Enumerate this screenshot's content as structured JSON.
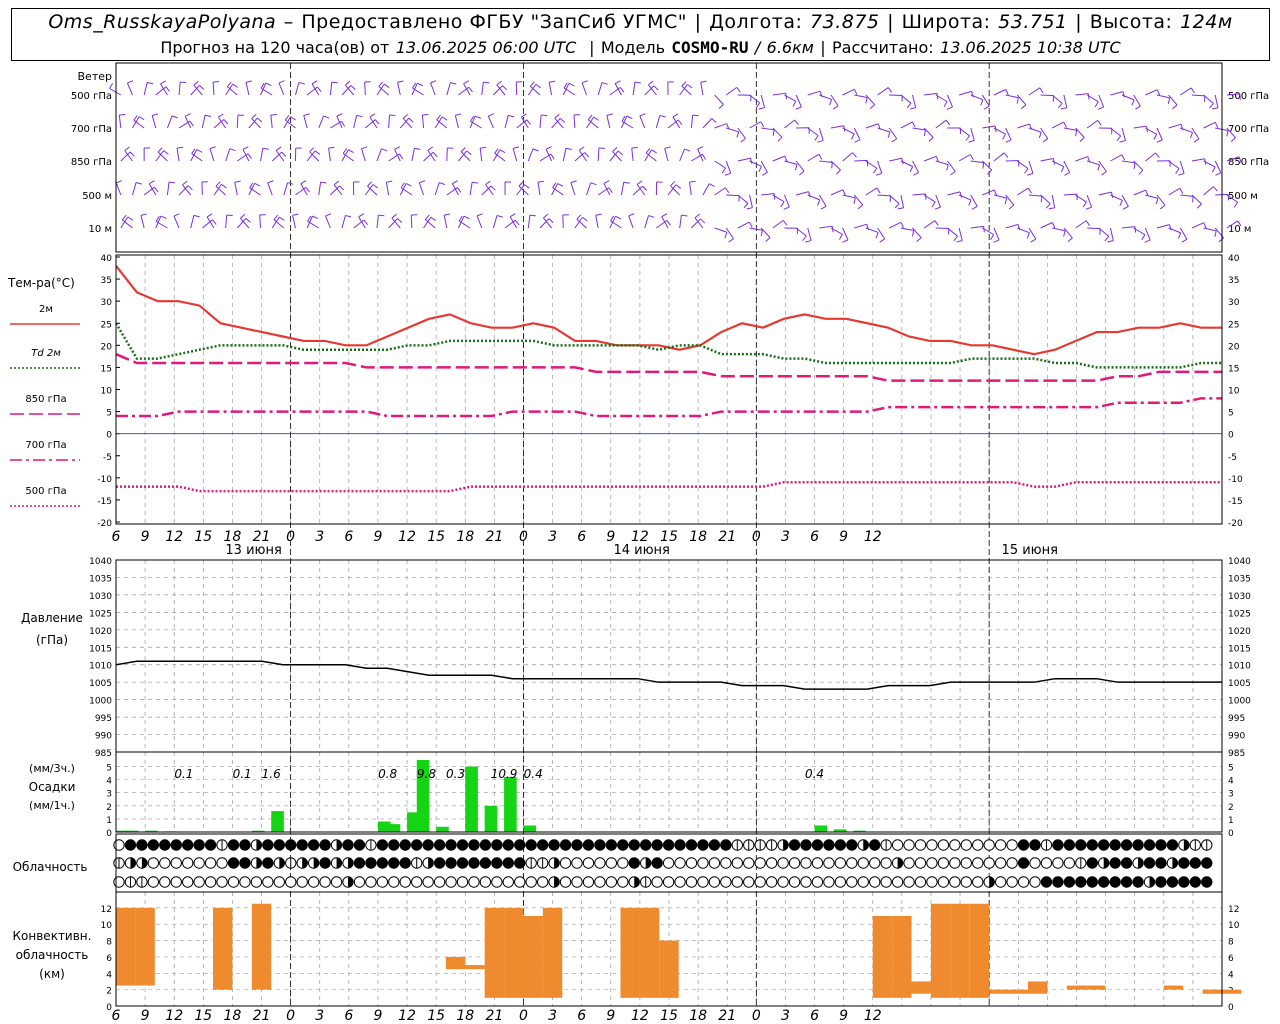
{
  "header": {
    "station": "Oms_RusskayaPolyana",
    "dash": "–",
    "provider": "Предоставлено ФГБУ \"ЗапСиб УГМС\"",
    "sep": "|",
    "lon_label": "Долгота:",
    "lon_value": "73.875",
    "lat_label": "Широта:",
    "lat_value": "53.751",
    "alt_label": "Высота:",
    "alt_value": "124м",
    "forecast_prefix": "Прогноз на 120 часа(ов) от",
    "forecast_time": "13.06.2025 06:00 UTC",
    "model_label": "Модель",
    "model_name": "COSMO-RU",
    "model_slash": "/",
    "model_res": "6.6км",
    "calc_label": "Рассчитано:",
    "calc_time": "13.06.2025 10:38 UTC"
  },
  "time_axis": {
    "hour_labels": [
      "6",
      "9",
      "12",
      "15",
      "18",
      "21",
      "0",
      "3",
      "6",
      "9",
      "12",
      "15",
      "18",
      "21",
      "0",
      "3",
      "6",
      "9",
      "12",
      "15",
      "18",
      "21",
      "0",
      "3",
      "6",
      "9",
      "12"
    ],
    "day_labels": [
      {
        "text": "13 июня",
        "hour": 8
      },
      {
        "text": "14 июня",
        "hour": 48
      },
      {
        "text": "15 июня",
        "hour": 88
      }
    ],
    "day_break_hours": [
      18,
      42,
      66,
      90
    ]
  },
  "wind_panel": {
    "title": "Ветер",
    "levels": [
      "500 гПа",
      "700 гПа",
      "850 гПа",
      "500 м",
      "10  м"
    ],
    "color": "#7a2ee0"
  },
  "temp_panel": {
    "title": "Тем-ра(°С)",
    "yticks": [
      "40",
      "35",
      "30",
      "25",
      "20",
      "15",
      "10",
      "5",
      "0",
      "-5",
      "-10",
      "-15",
      "-20"
    ],
    "legend": [
      {
        "label": "2м",
        "style": "solid",
        "color": "#e53a32"
      },
      {
        "label": "Td  2м",
        "style": "dotted",
        "color": "#1a6e1a"
      },
      {
        "label": "850 гПа",
        "style": "dashed",
        "color": "#e0197d"
      },
      {
        "label": "700 гПа",
        "style": "dashdot",
        "color": "#e0197d"
      },
      {
        "label": "500 гПа",
        "style": "dotted",
        "color": "#e0197d"
      }
    ]
  },
  "pressure_panel": {
    "title_line1": "Давление",
    "title_line2": "(гПа)",
    "yticks": [
      "1040",
      "1035",
      "1030",
      "1025",
      "1020",
      "1015",
      "1010",
      "1005",
      "1000",
      "995",
      "990",
      "985"
    ]
  },
  "precip_panel": {
    "title_line1": "(мм/3ч.)",
    "title_line2": "Осадки",
    "title_line3": "(мм/1ч.)",
    "yticks": [
      "5",
      "4",
      "3",
      "2",
      "1",
      "0"
    ],
    "labels": [
      {
        "hour": 7,
        "text": "0.1"
      },
      {
        "hour": 13,
        "text": "0.1"
      },
      {
        "hour": 16,
        "text": "1.6"
      },
      {
        "hour": 28,
        "text": "0.8"
      },
      {
        "hour": 32,
        "text": "9.8"
      },
      {
        "hour": 35,
        "text": "0.3"
      },
      {
        "hour": 40,
        "text": "10.9"
      },
      {
        "hour": 43,
        "text": "0.4"
      },
      {
        "hour": 72,
        "text": "0.4"
      }
    ],
    "color": "#14d414"
  },
  "cloud_panel": {
    "title": "Облачность"
  },
  "conv_panel": {
    "title_line1": "Конвективн.",
    "title_line2": "облачность",
    "title_line3": "(км)",
    "yticks": [
      "12",
      "10",
      "8",
      "6",
      "4",
      "2",
      "0"
    ],
    "color": "#f08a2e"
  },
  "chart_data": {
    "type": "line",
    "time_unit": "hours from 13.06.2025 06:00 UTC",
    "x": [
      0,
      2,
      4,
      6,
      8,
      10,
      12,
      14,
      16,
      18,
      20,
      22,
      24,
      26,
      28,
      30,
      32,
      34,
      36,
      38,
      40,
      42,
      44,
      46,
      48,
      50,
      52,
      54,
      56,
      58,
      60,
      62,
      64,
      66,
      68,
      70,
      72,
      74,
      76,
      78,
      80,
      82,
      84,
      86,
      88,
      90,
      92,
      94,
      96,
      98,
      100,
      102,
      104,
      106
    ],
    "series": [
      {
        "name": "2м",
        "values": [
          38,
          32,
          30,
          30,
          29,
          25,
          24,
          23,
          22,
          21,
          21,
          20,
          20,
          22,
          24,
          26,
          27,
          25,
          24,
          24,
          25,
          24,
          21,
          21,
          20,
          20,
          20,
          19,
          20,
          23,
          25,
          24,
          26,
          27,
          26,
          26,
          25,
          24,
          22,
          21,
          21,
          20,
          20,
          19,
          18,
          19,
          21,
          23,
          23,
          24,
          24,
          25,
          24,
          24
        ]
      },
      {
        "name": "Td  2м",
        "values": [
          25,
          17,
          17,
          18,
          19,
          20,
          20,
          20,
          20,
          19,
          19,
          19,
          19,
          19,
          20,
          20,
          21,
          21,
          21,
          21,
          21,
          20,
          20,
          20,
          20,
          20,
          19,
          20,
          20,
          18,
          18,
          18,
          17,
          17,
          16,
          16,
          16,
          16,
          16,
          16,
          16,
          17,
          17,
          17,
          17,
          16,
          16,
          15,
          15,
          15,
          15,
          15,
          16,
          16
        ]
      },
      {
        "name": "850 гПа",
        "values": [
          18,
          16,
          16,
          16,
          16,
          16,
          16,
          16,
          16,
          16,
          16,
          16,
          15,
          15,
          15,
          15,
          15,
          15,
          15,
          15,
          15,
          15,
          15,
          14,
          14,
          14,
          14,
          14,
          14,
          13,
          13,
          13,
          13,
          13,
          13,
          13,
          13,
          12,
          12,
          12,
          12,
          12,
          12,
          12,
          12,
          12,
          12,
          12,
          13,
          13,
          14,
          14,
          14,
          14
        ]
      },
      {
        "name": "700 гПа",
        "values": [
          4,
          4,
          4,
          5,
          5,
          5,
          5,
          5,
          5,
          5,
          5,
          5,
          5,
          4,
          4,
          4,
          4,
          4,
          4,
          5,
          5,
          5,
          5,
          4,
          4,
          4,
          4,
          4,
          4,
          5,
          5,
          5,
          5,
          5,
          5,
          5,
          5,
          6,
          6,
          6,
          6,
          6,
          6,
          6,
          6,
          6,
          6,
          6,
          7,
          7,
          7,
          7,
          8,
          8
        ]
      },
      {
        "name": "500 гПа",
        "values": [
          -12,
          -12,
          -12,
          -12,
          -13,
          -13,
          -13,
          -13,
          -13,
          -13,
          -13,
          -13,
          -13,
          -13,
          -13,
          -13,
          -13,
          -12,
          -12,
          -12,
          -12,
          -12,
          -12,
          -12,
          -12,
          -12,
          -12,
          -12,
          -12,
          -12,
          -12,
          -12,
          -11,
          -11,
          -11,
          -11,
          -11,
          -11,
          -11,
          -11,
          -11,
          -11,
          -11,
          -11,
          -12,
          -12,
          -11,
          -11,
          -11,
          -11,
          -11,
          -11,
          -11,
          -11
        ]
      },
      {
        "name": "Давление",
        "values": [
          1010,
          1011,
          1011,
          1011,
          1011,
          1011,
          1011,
          1011,
          1010,
          1010,
          1010,
          1010,
          1009,
          1009,
          1008,
          1007,
          1007,
          1007,
          1007,
          1006,
          1006,
          1006,
          1006,
          1006,
          1006,
          1006,
          1005,
          1005,
          1005,
          1005,
          1004,
          1004,
          1004,
          1003,
          1003,
          1003,
          1003,
          1004,
          1004,
          1004,
          1005,
          1005,
          1005,
          1005,
          1005,
          1006,
          1006,
          1006,
          1005,
          1005,
          1005,
          1005,
          1005,
          1005
        ]
      }
    ],
    "precip_bars": [
      {
        "hour": 0,
        "value": 0.1
      },
      {
        "hour": 1,
        "value": 0.1
      },
      {
        "hour": 3,
        "value": 0.1
      },
      {
        "hour": 5,
        "value": 0.05
      },
      {
        "hour": 14,
        "value": 0.1
      },
      {
        "hour": 16,
        "value": 1.6
      },
      {
        "hour": 27,
        "value": 0.8
      },
      {
        "hour": 28,
        "value": 0.6
      },
      {
        "hour": 30,
        "value": 1.5
      },
      {
        "hour": 31,
        "value": 5.5
      },
      {
        "hour": 33,
        "value": 0.4
      },
      {
        "hour": 36,
        "value": 5.0
      },
      {
        "hour": 38,
        "value": 2.0
      },
      {
        "hour": 40,
        "value": 4.2
      },
      {
        "hour": 42,
        "value": 0.5
      },
      {
        "hour": 72,
        "value": 0.5
      },
      {
        "hour": 74,
        "value": 0.2
      },
      {
        "hour": 76,
        "value": 0.1
      }
    ],
    "conv_bars": [
      {
        "hour": 0,
        "bottom": 2.5,
        "top": 12
      },
      {
        "hour": 2,
        "bottom": 2.5,
        "top": 12
      },
      {
        "hour": 10,
        "bottom": 2,
        "top": 12
      },
      {
        "hour": 14,
        "bottom": 2,
        "top": 12.5
      },
      {
        "hour": 34,
        "bottom": 4.5,
        "top": 6
      },
      {
        "hour": 36,
        "bottom": 4.5,
        "top": 5
      },
      {
        "hour": 38,
        "bottom": 1,
        "top": 12
      },
      {
        "hour": 40,
        "bottom": 1,
        "top": 12
      },
      {
        "hour": 42,
        "bottom": 1,
        "top": 11
      },
      {
        "hour": 44,
        "bottom": 1,
        "top": 12
      },
      {
        "hour": 52,
        "bottom": 1,
        "top": 12
      },
      {
        "hour": 54,
        "bottom": 1,
        "top": 12
      },
      {
        "hour": 56,
        "bottom": 1,
        "top": 8
      },
      {
        "hour": 78,
        "bottom": 1,
        "top": 11
      },
      {
        "hour": 80,
        "bottom": 1,
        "top": 11
      },
      {
        "hour": 82,
        "bottom": 1.5,
        "top": 3
      },
      {
        "hour": 84,
        "bottom": 1,
        "top": 12.5
      },
      {
        "hour": 86,
        "bottom": 1,
        "top": 12.5
      },
      {
        "hour": 88,
        "bottom": 1,
        "top": 12.5
      },
      {
        "hour": 90,
        "bottom": 1.5,
        "top": 2
      },
      {
        "hour": 92,
        "bottom": 1.5,
        "top": 2
      },
      {
        "hour": 94,
        "bottom": 1.5,
        "top": 3
      },
      {
        "hour": 98,
        "bottom": 2,
        "top": 2.5
      },
      {
        "hour": 100,
        "bottom": 2,
        "top": 2.5
      },
      {
        "hour": 108,
        "bottom": 2,
        "top": 2.5
      },
      {
        "hour": 112,
        "bottom": 1.5,
        "top": 2
      },
      {
        "hour": 114,
        "bottom": 1.5,
        "top": 2
      }
    ],
    "cloud_rows": {
      "row1": [
        1,
        4,
        4,
        4,
        4,
        4,
        4,
        4,
        4,
        2,
        4,
        4,
        3,
        4,
        4,
        4,
        4,
        4,
        4,
        3,
        4,
        4,
        2,
        4,
        4,
        4,
        4,
        4,
        4,
        4,
        4,
        4,
        4,
        4,
        4,
        4,
        4,
        4,
        4,
        4,
        4,
        4,
        4,
        4,
        4,
        4,
        4,
        4,
        4,
        4,
        4,
        4,
        4,
        4,
        2,
        2,
        2,
        2,
        3,
        4,
        4,
        4,
        4,
        4,
        4,
        3,
        4,
        2,
        1,
        1,
        1,
        1,
        1,
        1,
        1,
        1,
        1,
        1,
        1,
        4,
        4,
        2,
        4,
        4,
        4,
        4,
        4,
        4,
        4,
        4,
        4,
        4,
        4,
        3,
        2,
        2
      ],
      "row2": [
        2,
        3,
        3,
        1,
        1,
        1,
        1,
        1,
        1,
        1,
        4,
        4,
        3,
        4,
        3,
        2,
        3,
        3,
        4,
        3,
        3,
        4,
        4,
        4,
        4,
        4,
        2,
        3,
        4,
        4,
        4,
        4,
        4,
        4,
        4,
        4,
        2,
        2,
        3,
        1,
        1,
        1,
        1,
        1,
        1,
        4,
        3,
        4,
        1,
        1,
        1,
        1,
        1,
        1,
        1,
        1,
        1,
        1,
        1,
        1,
        1,
        1,
        1,
        1,
        1,
        1,
        1,
        1,
        3,
        1,
        1,
        1,
        1,
        1,
        1,
        1,
        1,
        1,
        1,
        4,
        1,
        1,
        1,
        1,
        2,
        4,
        3,
        4,
        4,
        3,
        4,
        4,
        3,
        4,
        4,
        4
      ],
      "row3": [
        1,
        2,
        2,
        1,
        1,
        1,
        1,
        1,
        1,
        1,
        1,
        1,
        1,
        1,
        1,
        1,
        1,
        1,
        1,
        1,
        3,
        1,
        1,
        1,
        1,
        1,
        1,
        1,
        1,
        1,
        1,
        1,
        1,
        1,
        1,
        1,
        1,
        1,
        3,
        1,
        1,
        1,
        1,
        1,
        1,
        3,
        2,
        1,
        1,
        1,
        1,
        1,
        1,
        1,
        1,
        1,
        1,
        1,
        1,
        1,
        1,
        1,
        1,
        1,
        1,
        1,
        1,
        1,
        1,
        1,
        1,
        1,
        1,
        1,
        1,
        1,
        3,
        1,
        1,
        1,
        1,
        4,
        4,
        4,
        4,
        4,
        4,
        4,
        4,
        4,
        3,
        4,
        4,
        4,
        4,
        4
      ]
    }
  }
}
